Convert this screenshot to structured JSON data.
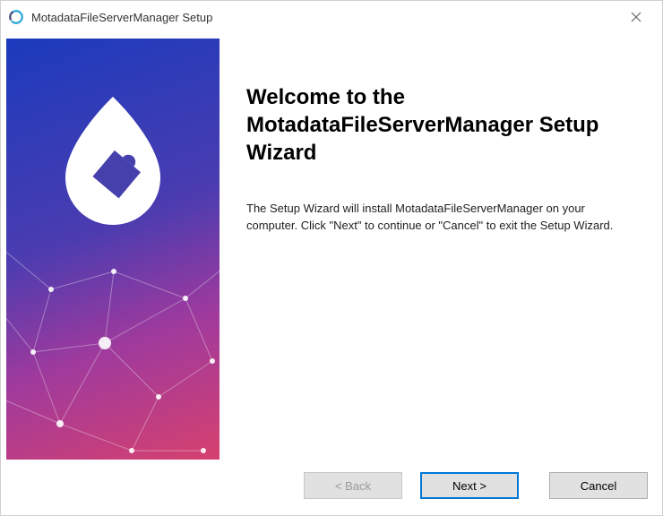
{
  "titlebar": {
    "title": "MotadataFileServerManager Setup"
  },
  "content": {
    "heading": "Welcome to the MotadataFileServerManager Setup Wizard",
    "body": "The Setup Wizard will install MotadataFileServerManager on your computer.  Click \"Next\" to continue or \"Cancel\" to exit the Setup Wizard."
  },
  "buttons": {
    "back": "< Back",
    "next": "Next >",
    "cancel": "Cancel"
  }
}
